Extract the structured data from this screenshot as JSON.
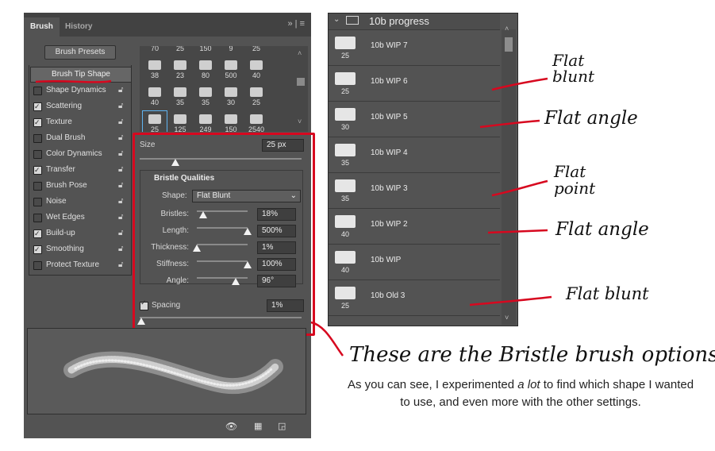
{
  "brush_panel": {
    "tabs": [
      {
        "label": "Brush",
        "active": true
      },
      {
        "label": "History",
        "active": false
      }
    ],
    "menu_icons": "» | ≡",
    "brush_presets_button": "Brush Presets",
    "brush_tip_shape": "Brush Tip Shape",
    "options": [
      {
        "label": "Shape Dynamics",
        "checked": false
      },
      {
        "label": "Scattering",
        "checked": true
      },
      {
        "label": "Texture",
        "checked": true
      },
      {
        "label": "Dual Brush",
        "checked": false
      },
      {
        "label": "Color Dynamics",
        "checked": false
      },
      {
        "label": "Transfer",
        "checked": true
      },
      {
        "label": "Brush Pose",
        "checked": false
      },
      {
        "label": "Noise",
        "checked": false
      },
      {
        "label": "Wet Edges",
        "checked": false
      },
      {
        "label": "Build-up",
        "checked": true
      },
      {
        "label": "Smoothing",
        "checked": true
      },
      {
        "label": "Protect Texture",
        "checked": false
      }
    ],
    "tip_rows": [
      [
        "70",
        "25",
        "150",
        "9",
        "25"
      ],
      [
        "38",
        "23",
        "80",
        "500",
        "40"
      ],
      [
        "40",
        "35",
        "35",
        "30",
        "25"
      ],
      [
        "25",
        "125",
        "249",
        "150",
        "2540"
      ]
    ],
    "size": {
      "label": "Size",
      "value": "25 px"
    },
    "bristle_qualities": {
      "heading": "Bristle Qualities",
      "shape_label": "Shape:",
      "shape_value": "Flat Blunt",
      "params": [
        {
          "label": "Bristles:",
          "value": "18%",
          "level": 0.12
        },
        {
          "label": "Length:",
          "value": "500%",
          "level": 1.0
        },
        {
          "label": "Thickness:",
          "value": "1%",
          "level": 0.0
        },
        {
          "label": "Stiffness:",
          "value": "100%",
          "level": 1.0
        },
        {
          "label": "Angle:",
          "value": "96°",
          "level": 0.77
        }
      ]
    },
    "spacing": {
      "label": "Spacing",
      "value": "1%",
      "checked": true
    }
  },
  "layers_panel": {
    "group_name": "10b progress",
    "layers": [
      {
        "name": "10b WIP 7",
        "size": "25"
      },
      {
        "name": "10b WIP 6",
        "size": "25"
      },
      {
        "name": "10b WIP 5",
        "size": "30"
      },
      {
        "name": "10b WIP 4",
        "size": "35"
      },
      {
        "name": "10b WIP 3",
        "size": "35"
      },
      {
        "name": "10b WIP 2",
        "size": "40"
      },
      {
        "name": "10b WIP",
        "size": "40"
      },
      {
        "name": "10b Old 3",
        "size": "25"
      }
    ]
  },
  "annotations": {
    "notes": [
      "Flat blunt",
      "Flat angle",
      "Flat point",
      "Flat angle",
      "Flat blunt"
    ],
    "headline": "These are the Bristle brush options",
    "caption_before": "As you can see, I experimented ",
    "caption_emph": "a lot",
    "caption_after": " to find which shape I wanted to use, and even more with the other settings.",
    "accent_color": "#d7081f"
  }
}
